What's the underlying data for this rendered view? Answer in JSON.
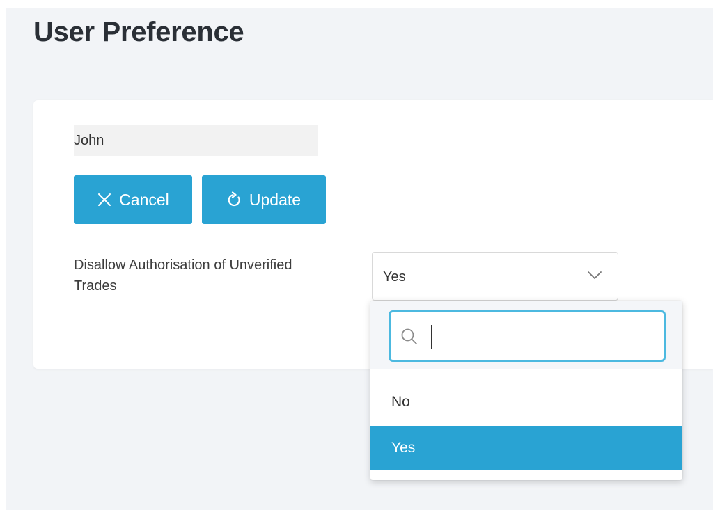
{
  "page": {
    "title": "User Preference"
  },
  "form": {
    "name_value": "John",
    "cancel_label": "Cancel",
    "update_label": "Update",
    "disallow_label": "Disallow Authorisation of Unverified Trades",
    "disallow_selected": "Yes"
  },
  "dropdown": {
    "search_value": "",
    "options": [
      {
        "label": "No",
        "selected": false
      },
      {
        "label": "Yes",
        "selected": true
      }
    ]
  },
  "icons": {
    "cancel": "close-icon",
    "update": "refresh-icon",
    "select": "chevron-down-icon",
    "search": "search-icon"
  },
  "colors": {
    "accent": "#29a3d3",
    "focus_border": "#4cb9e0",
    "page_background": "#f2f4f7"
  }
}
